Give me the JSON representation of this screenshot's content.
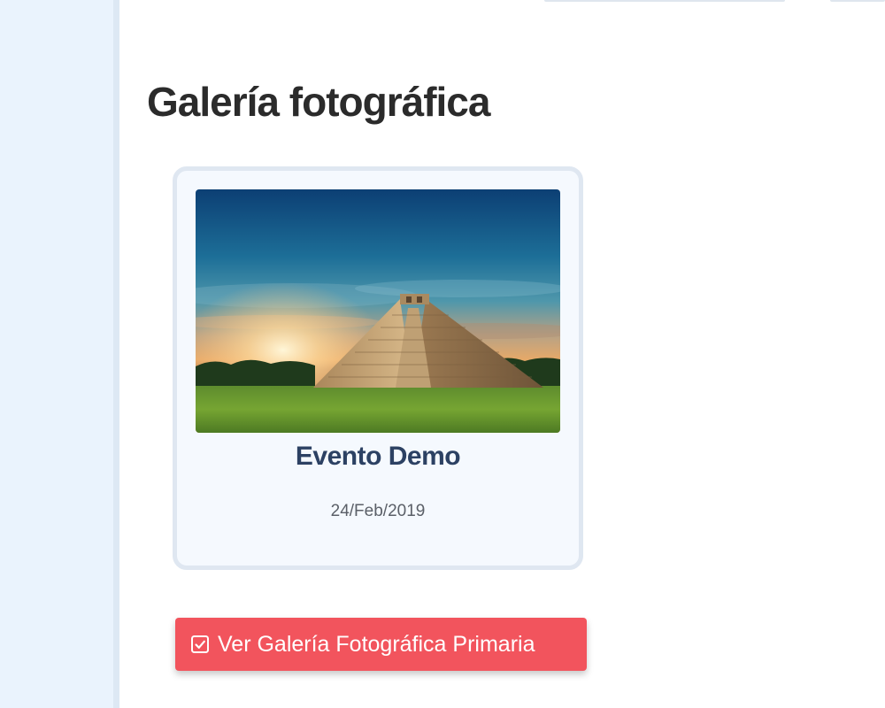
{
  "page": {
    "title": "Galería fotográfica"
  },
  "gallery": {
    "items": [
      {
        "title": "Evento Demo",
        "date": "24/Feb/2019",
        "image": "pyramid-photo"
      }
    ]
  },
  "actions": {
    "primary_gallery_label": "Ver Galería Fotográfica Primaria",
    "primary_gallery_icon": "check-square-icon"
  },
  "colors": {
    "sidebar": "#eaf3fd",
    "card_border": "#dfe7f1",
    "card_title": "#2c4163",
    "button": "#f2545d"
  }
}
